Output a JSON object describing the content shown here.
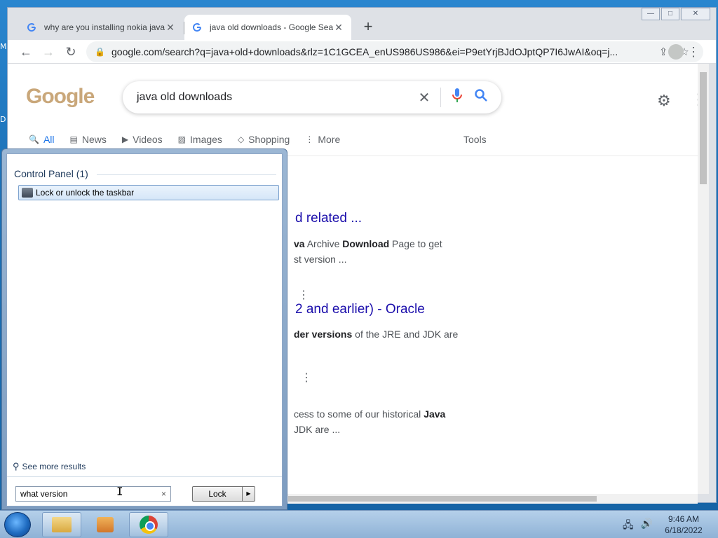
{
  "desktop": {
    "edge_labels": [
      "M",
      "D"
    ]
  },
  "browser": {
    "tabs": [
      {
        "title": "why are you installing nokia java",
        "active": false
      },
      {
        "title": "java old downloads - Google Sea",
        "active": true
      }
    ],
    "new_tab": "+",
    "window_controls": {
      "minimize": "—",
      "maximize": "□",
      "close": "✕"
    },
    "url": "google.com/search?q=java+old+downloads&rlz=1C1GCEA_enUS986US986&ei=P9etYrjBJdOJptQP7I6JwAI&oq=j..."
  },
  "google": {
    "logo": "Google",
    "query": "java old downloads",
    "nav_tabs": [
      {
        "label": "All",
        "icon": "search-icon"
      },
      {
        "label": "News",
        "icon": "news-icon"
      },
      {
        "label": "Videos",
        "icon": "video-icon"
      },
      {
        "label": "Images",
        "icon": "image-icon"
      },
      {
        "label": "Shopping",
        "icon": "tag-icon"
      },
      {
        "label": "More",
        "icon": "more-vert-icon"
      }
    ],
    "tools": "Tools",
    "results": [
      {
        "title": "d related ...",
        "snippet_parts": [
          "va",
          " Archive ",
          "Download",
          " Page to get"
        ],
        "snippet_line2": "st version ..."
      },
      {
        "title": "2 and earlier) - Oracle",
        "snippet_parts": [
          "der versions",
          " of the JRE and JDK are"
        ]
      },
      {
        "snippet_parts": [
          "cess to some of our historical ",
          "Java"
        ],
        "snippet_line2": " JDK are ..."
      }
    ]
  },
  "start_menu": {
    "heading": "Control Panel (1)",
    "item": "Lock or unlock the taskbar",
    "see_more": "See more results",
    "search_value": "what version",
    "search_clear": "×",
    "lock_button": "Lock",
    "lock_arrow": "▶"
  },
  "taskbar": {
    "time": "9:46 AM",
    "date": "6/18/2022"
  }
}
